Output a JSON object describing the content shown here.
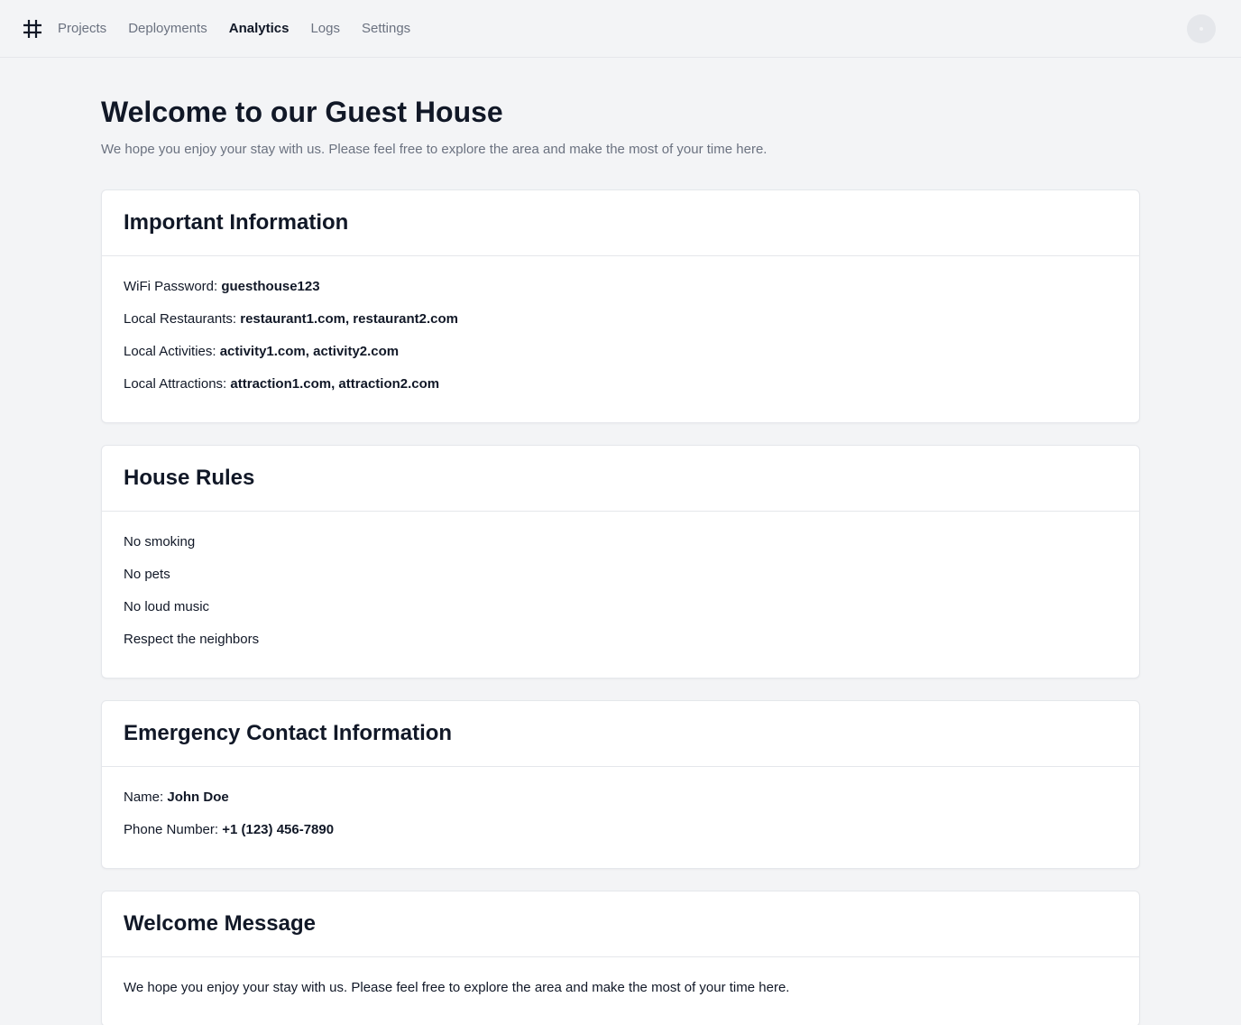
{
  "nav": {
    "logo_icon": "hash-icon",
    "items": [
      {
        "label": "Projects",
        "active": false
      },
      {
        "label": "Deployments",
        "active": false
      },
      {
        "label": "Analytics",
        "active": true
      },
      {
        "label": "Logs",
        "active": false
      },
      {
        "label": "Settings",
        "active": false
      }
    ]
  },
  "page": {
    "title": "Welcome to our Guest House",
    "subtitle": "We hope you enjoy your stay with us. Please feel free to explore the area and make the most of your time here."
  },
  "cards": {
    "important": {
      "title": "Important Information",
      "wifi_label": "WiFi Password:",
      "wifi_value": "guesthouse123",
      "restaurants_label": "Local Restaurants:",
      "restaurants_value": "restaurant1.com, restaurant2.com",
      "activities_label": "Local Activities:",
      "activities_value": "activity1.com, activity2.com",
      "attractions_label": "Local Attractions:",
      "attractions_value": "attraction1.com, attraction2.com"
    },
    "rules": {
      "title": "House Rules",
      "items": [
        "No smoking",
        "No pets",
        "No loud music",
        "Respect the neighbors"
      ]
    },
    "emergency": {
      "title": "Emergency Contact Information",
      "name_label": "Name:",
      "name_value": "John Doe",
      "phone_label": "Phone Number:",
      "phone_value": "+1 (123) 456-7890"
    },
    "welcome": {
      "title": "Welcome Message",
      "text": "We hope you enjoy your stay with us. Please feel free to explore the area and make the most of your time here."
    }
  }
}
